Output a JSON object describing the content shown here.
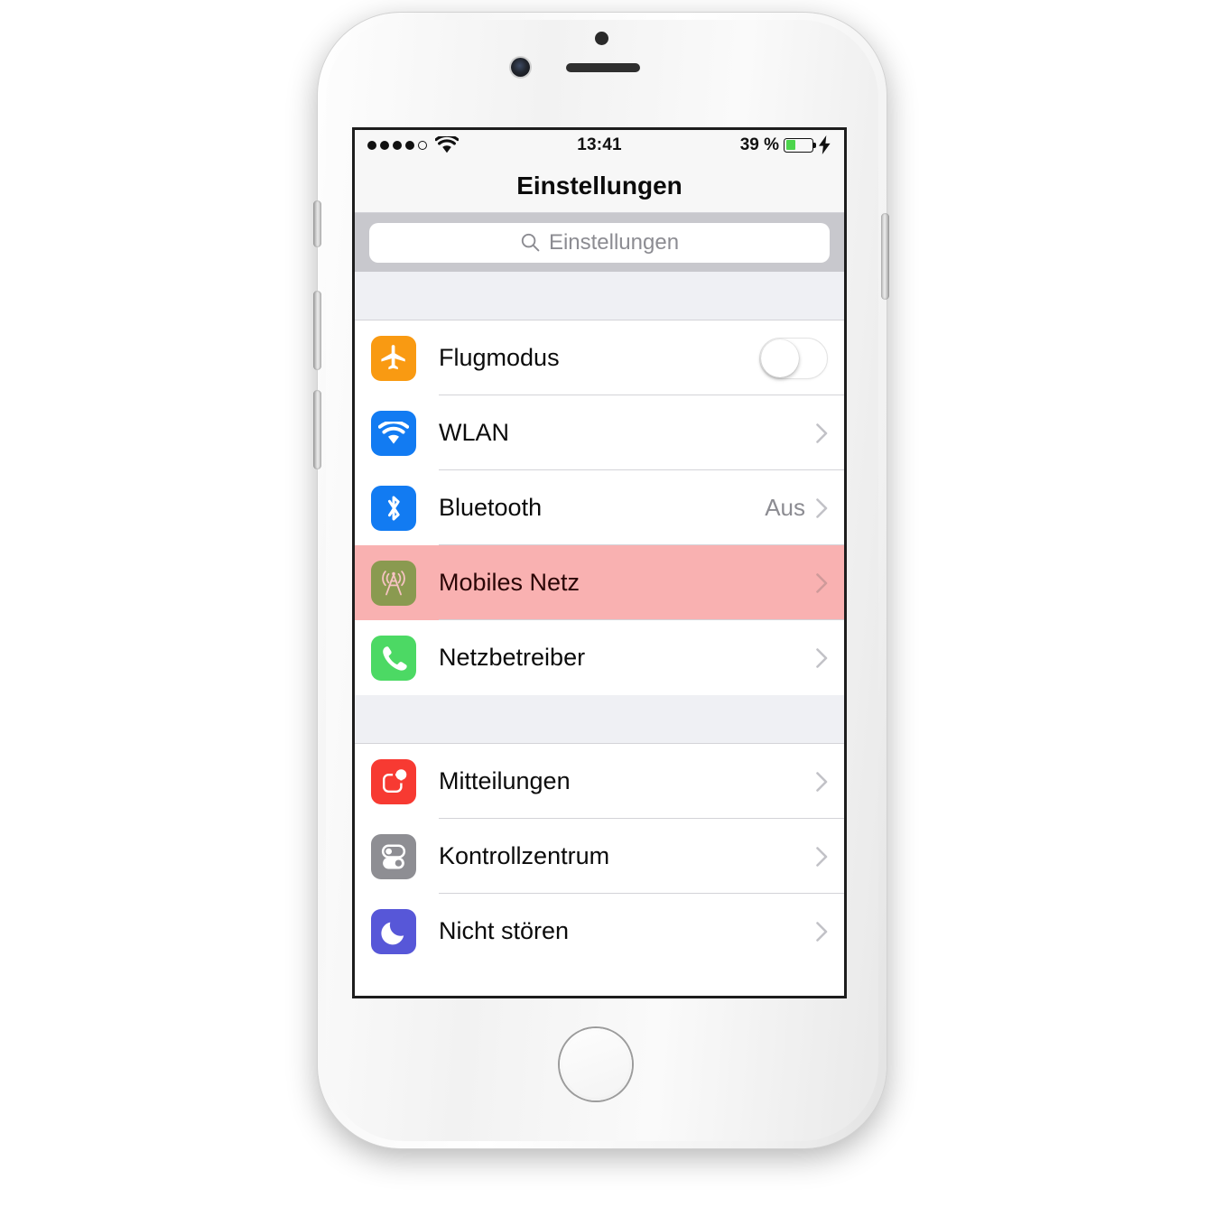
{
  "device": {
    "name": "iPhone",
    "hardware": {
      "mute_switch": "mute-switch",
      "volume_up": "volume-up-button",
      "volume_down": "volume-down-button",
      "power": "power-button",
      "home": "home-button"
    }
  },
  "status_bar": {
    "signal_dots_filled": 4,
    "signal_dots_total": 5,
    "wifi": "wifi-icon",
    "time": "13:41",
    "battery_percent_label": "39 %",
    "battery_level": 39,
    "charging": true,
    "battery_color": "#4cd54c"
  },
  "nav": {
    "title": "Einstellungen"
  },
  "search": {
    "placeholder": "Einstellungen",
    "value": "",
    "icon": "search-icon"
  },
  "colors": {
    "highlight": "#f9b1b1",
    "group_background": "#eff0f4",
    "separator": "#d3d3d8",
    "search_bar": "#c8c8cd"
  },
  "sections": [
    {
      "id": "connectivity",
      "rows": [
        {
          "id": "flugmodus",
          "label": "Flugmodus",
          "icon": "airplane-icon",
          "icon_color": "#f99a12",
          "accessory": "toggle",
          "toggle_on": false,
          "value": "",
          "highlighted": false
        },
        {
          "id": "wlan",
          "label": "WLAN",
          "icon": "wifi-icon",
          "icon_color": "#127bf2",
          "accessory": "chevron",
          "value": "",
          "highlighted": false
        },
        {
          "id": "bluetooth",
          "label": "Bluetooth",
          "icon": "bluetooth-icon",
          "icon_color": "#127bf2",
          "accessory": "chevron",
          "value": "Aus",
          "highlighted": false
        },
        {
          "id": "mobiles-netz",
          "label": "Mobiles Netz",
          "icon": "cell-tower-icon",
          "icon_color": "#8a9a50",
          "accessory": "chevron",
          "value": "",
          "highlighted": true
        },
        {
          "id": "netzbetreiber",
          "label": "Netzbetreiber",
          "icon": "phone-icon",
          "icon_color": "#4cd964",
          "accessory": "chevron",
          "value": "",
          "highlighted": false
        }
      ]
    },
    {
      "id": "notifications",
      "rows": [
        {
          "id": "mitteilungen",
          "label": "Mitteilungen",
          "icon": "notification-badge-icon",
          "icon_color": "#f73a32",
          "accessory": "chevron",
          "value": "",
          "highlighted": false
        },
        {
          "id": "kontrollzentrum",
          "label": "Kontrollzentrum",
          "icon": "control-center-icon",
          "icon_color": "#8e8e93",
          "accessory": "chevron",
          "value": "",
          "highlighted": false
        },
        {
          "id": "nicht-stoeren",
          "label": "Nicht stören",
          "icon": "moon-icon",
          "icon_color": "#5757d8",
          "accessory": "chevron",
          "value": "",
          "highlighted": false
        }
      ]
    }
  ]
}
